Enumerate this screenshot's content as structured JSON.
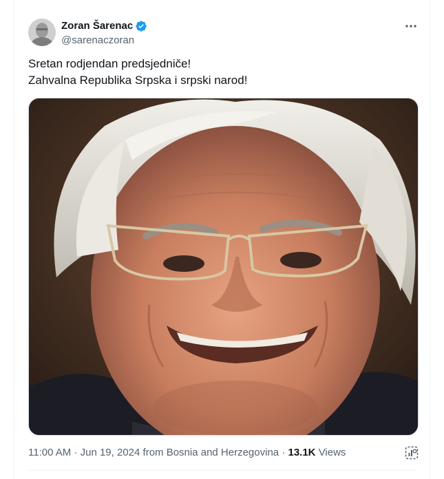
{
  "author": {
    "display_name": "Zoran Šarenac",
    "handle": "@sarenaczoran",
    "verified": true,
    "verified_color": "#1d9bf0"
  },
  "tweet": {
    "lines": [
      "Sretan rodjendan predsjedniče!",
      "Zahvalna Republika Srpska i srpski narod!"
    ],
    "media": {
      "type": "photo",
      "description_icon": "photo-portrait"
    }
  },
  "meta": {
    "time": "11:00 AM",
    "separator": "·",
    "date": "Jun 19, 2024",
    "source": "from Bosnia and Herzegovina",
    "views_count": "13.1K",
    "views_label": "Views"
  },
  "icons": {
    "more": "more-icon",
    "verified": "verified-badge-icon",
    "analytics": "analytics-icon"
  },
  "colors": {
    "text_primary": "#0f1419",
    "text_secondary": "#536471",
    "accent": "#1d9bf0"
  }
}
